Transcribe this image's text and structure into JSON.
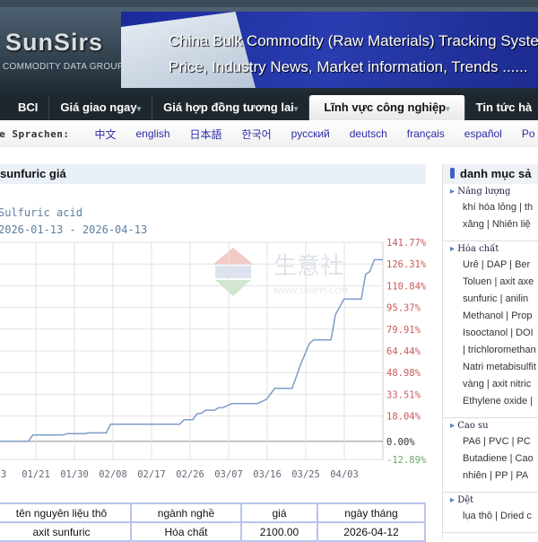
{
  "header": {
    "logo": "SunSirs",
    "logo_sub": "COMMODITY DATA GROUP",
    "banner_line1": "China Bulk Commodity (Raw Materials) Tracking System",
    "banner_line2": "Price, Industry News, Market information, Trends ......"
  },
  "nav": [
    {
      "label": "BCI"
    },
    {
      "label": "Giá giao ngay",
      "caret": "▾"
    },
    {
      "label": "Giá hợp đồng tương lai",
      "caret": "▾"
    },
    {
      "label": "Lĩnh vực công nghiệp",
      "caret": "▾",
      "active": true
    },
    {
      "label": "Tin tức hà"
    }
  ],
  "languages": {
    "label": "te Sprachen:",
    "items": [
      "中文",
      "english",
      "日本語",
      "한국어",
      "русский",
      "deutsch",
      "français",
      "español",
      "Po"
    ]
  },
  "page_title": "sunfuric giá",
  "chart_data": {
    "type": "line",
    "title": "Sulfuric acid",
    "subtitle": "2026-01-13 - 2026-04-13",
    "line_color": "#7d9cc8",
    "y_ticks": [
      "141.77%",
      "126.31%",
      "110.84%",
      "95.37%",
      "79.91%",
      "64.44%",
      "48.98%",
      "33.51%",
      "18.04%",
      "0.00%",
      "-12.89%"
    ],
    "y_tick_values": [
      141.77,
      126.31,
      110.84,
      95.37,
      79.91,
      64.44,
      48.98,
      33.51,
      18.04,
      0,
      -12.89
    ],
    "ylim": [
      -12.89,
      141.77
    ],
    "x_ticks": [
      "13",
      "01/21",
      "01/30",
      "02/08",
      "02/17",
      "02/26",
      "03/07",
      "03/16",
      "03/25",
      "04/03"
    ],
    "x_range": [
      "2026-01-13",
      "2026-04-12"
    ],
    "points": [
      [
        "2026-01-13",
        0
      ],
      [
        "2026-01-20",
        0
      ],
      [
        "2026-01-21",
        4.5
      ],
      [
        "2026-01-28",
        4.5
      ],
      [
        "2026-01-29",
        5.5
      ],
      [
        "2026-02-02",
        5.5
      ],
      [
        "2026-02-03",
        6
      ],
      [
        "2026-02-07",
        6
      ],
      [
        "2026-02-08",
        12.2
      ],
      [
        "2026-02-24",
        12.2
      ],
      [
        "2026-02-25",
        15.4
      ],
      [
        "2026-02-27",
        15.4
      ],
      [
        "2026-02-28",
        19.6
      ],
      [
        "2026-03-01",
        20
      ],
      [
        "2026-03-02",
        22.2
      ],
      [
        "2026-03-04",
        22.2
      ],
      [
        "2026-03-05",
        23.9
      ],
      [
        "2026-03-06",
        24
      ],
      [
        "2026-03-08",
        26.9
      ],
      [
        "2026-03-14",
        26.9
      ],
      [
        "2026-03-16",
        29.8
      ],
      [
        "2026-03-18",
        37.7
      ],
      [
        "2026-03-22",
        37.7
      ],
      [
        "2026-03-24",
        55
      ],
      [
        "2026-03-26",
        69.7
      ],
      [
        "2026-03-27",
        72.3
      ],
      [
        "2026-03-31",
        72.3
      ],
      [
        "2026-04-01",
        90
      ],
      [
        "2026-04-03",
        101.3
      ],
      [
        "2026-04-07",
        101.3
      ],
      [
        "2026-04-08",
        118.8
      ],
      [
        "2026-04-09",
        121
      ],
      [
        "2026-04-10",
        129.4
      ],
      [
        "2026-04-12",
        129.4
      ]
    ],
    "grid": true,
    "watermark": "生意社 WWW.100PPI.COM"
  },
  "table": {
    "headers": [
      "tên nguyên liệu thô",
      "ngành nghề",
      "giá",
      "ngày tháng"
    ],
    "rows": [
      [
        "axit sunfuric",
        "Hóa chất",
        "2100.00",
        "2026-04-12"
      ]
    ]
  },
  "sidebar": {
    "title": "danh mục sả",
    "categories": [
      {
        "title": "Năng lượng",
        "lines": [
          "khí hóa lỏng | th",
          "xăng | Nhiên liệ"
        ]
      },
      {
        "title": "Hóa chất",
        "lines": [
          "Urê | DAP | Ber",
          "Toluen | axit axe",
          "sunfuric | anilin",
          "Methanol | Prop",
          "Isooctanol | DOI",
          "| trichloromethan",
          "Natri metabisulfit",
          "vàng | axit nitric",
          "Ethylene oxide |"
        ]
      },
      {
        "title": "Cao su",
        "lines": [
          "PA6 | PVC | PC",
          "Butadiene | Cao",
          "nhiên | PP | PA"
        ]
      },
      {
        "title": "Dệt",
        "lines": [
          "lụa thô | Dried c"
        ]
      }
    ]
  }
}
